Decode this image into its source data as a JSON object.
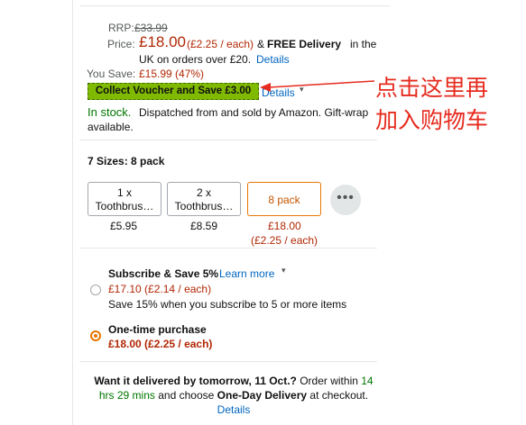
{
  "price_block": {
    "rrp_label": "RRP:",
    "rrp_value": "£33.99",
    "price_label": "Price:",
    "price_value": "£18.00",
    "per_each": "(£2.25 / each)",
    "amp": "&",
    "free_delivery": "FREE Delivery",
    "delivery_line1_rest": "in the",
    "delivery_line2": "UK on orders over £20.",
    "details_link": "Details",
    "you_save_label": "You Save:",
    "you_save_value": "£15.99 (47%)"
  },
  "voucher": {
    "label": "Collect Voucher and Save £3.00",
    "details_link": "Details",
    "chevron": "▾"
  },
  "stock": {
    "status": "In stock.",
    "dispatch_line1": "Dispatched from and sold by Amazon. Gift-wrap",
    "dispatch_line2": "available."
  },
  "sizes": {
    "heading": "7 Sizes: 8 pack",
    "options": [
      {
        "line1": "1 x",
        "line2": "Toothbrus…",
        "price": "£5.95"
      },
      {
        "line1": "2 x",
        "line2": "Toothbrus…",
        "price": "£8.59"
      },
      {
        "label": "8 pack",
        "price": "£18.00",
        "per_each": "(£2.25 / each)",
        "selected": true
      }
    ],
    "more_icon": "•••"
  },
  "subscribe": {
    "title": "Subscribe & Save 5%",
    "learn_more": "Learn more",
    "chevron": "▾",
    "price": "£17.10 (£2.14 / each)",
    "note": "Save 15% when you subscribe to 5 or more items"
  },
  "one_time": {
    "title": "One-time purchase",
    "price": "£18.00 (£2.25 / each)"
  },
  "delivery": {
    "line1_a": "Want it delivered by tomorrow, 11 Oct.?",
    "line1_b": "Order within",
    "line1_c": "14",
    "line2_a": "hrs 29 mins",
    "line2_b": "and choose",
    "line2_c": "One-Day Delivery",
    "line2_d": "at checkout.",
    "details_link": "Details"
  },
  "annotation": {
    "line1": "点击这里再",
    "line2": "加入购物车",
    "color": "#e62b1e"
  }
}
